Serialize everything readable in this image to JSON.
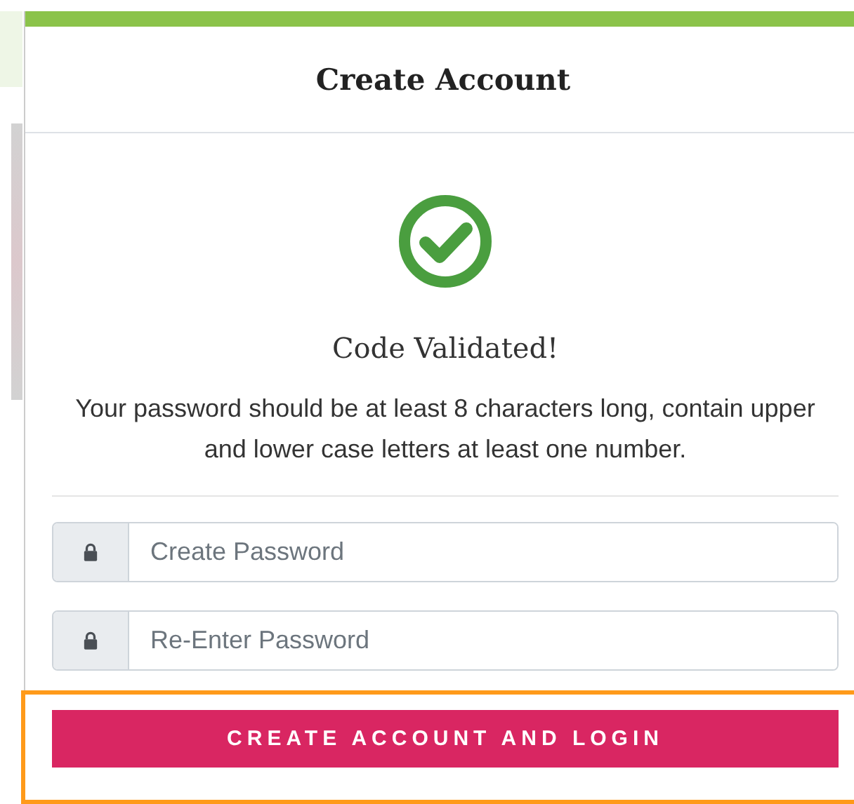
{
  "modal": {
    "title": "Create Account"
  },
  "status": {
    "heading": "Code Validated!",
    "message": "Your password should be at least 8 characters long, contain upper and lower case letters at least one number."
  },
  "fields": [
    {
      "placeholder": "Create Password"
    },
    {
      "placeholder": "Re-Enter Password"
    }
  ],
  "submit": {
    "label": "CREATE ACCOUNT AND LOGIN",
    "focused": true
  }
}
